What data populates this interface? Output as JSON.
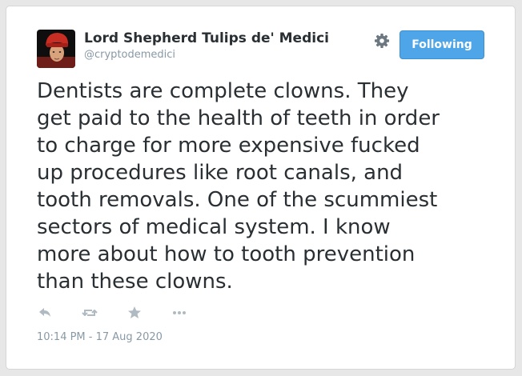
{
  "author": {
    "display_name": "Lord Shepherd Tulips de' Medici",
    "handle": "@cryptodemedici"
  },
  "follow_button": {
    "label": "Following",
    "color": "#4ea6e8"
  },
  "settings_icon": "gear-icon",
  "tweet": {
    "lines": [
      "Dentists are complete clowns. They",
      "get paid to the health of teeth in order",
      "to charge for more expensive fucked",
      "up procedures like root canals, and",
      "tooth removals. One of the scummiest",
      "sectors of medical system. I know",
      "more about how to tooth prevention",
      "than these clowns."
    ],
    "timestamp": "10:14 PM - 17 Aug 2020"
  },
  "actions": [
    {
      "icon": "reply-icon"
    },
    {
      "icon": "retweet-icon"
    },
    {
      "icon": "favorite-star-icon"
    },
    {
      "icon": "more-dots-icon"
    }
  ]
}
